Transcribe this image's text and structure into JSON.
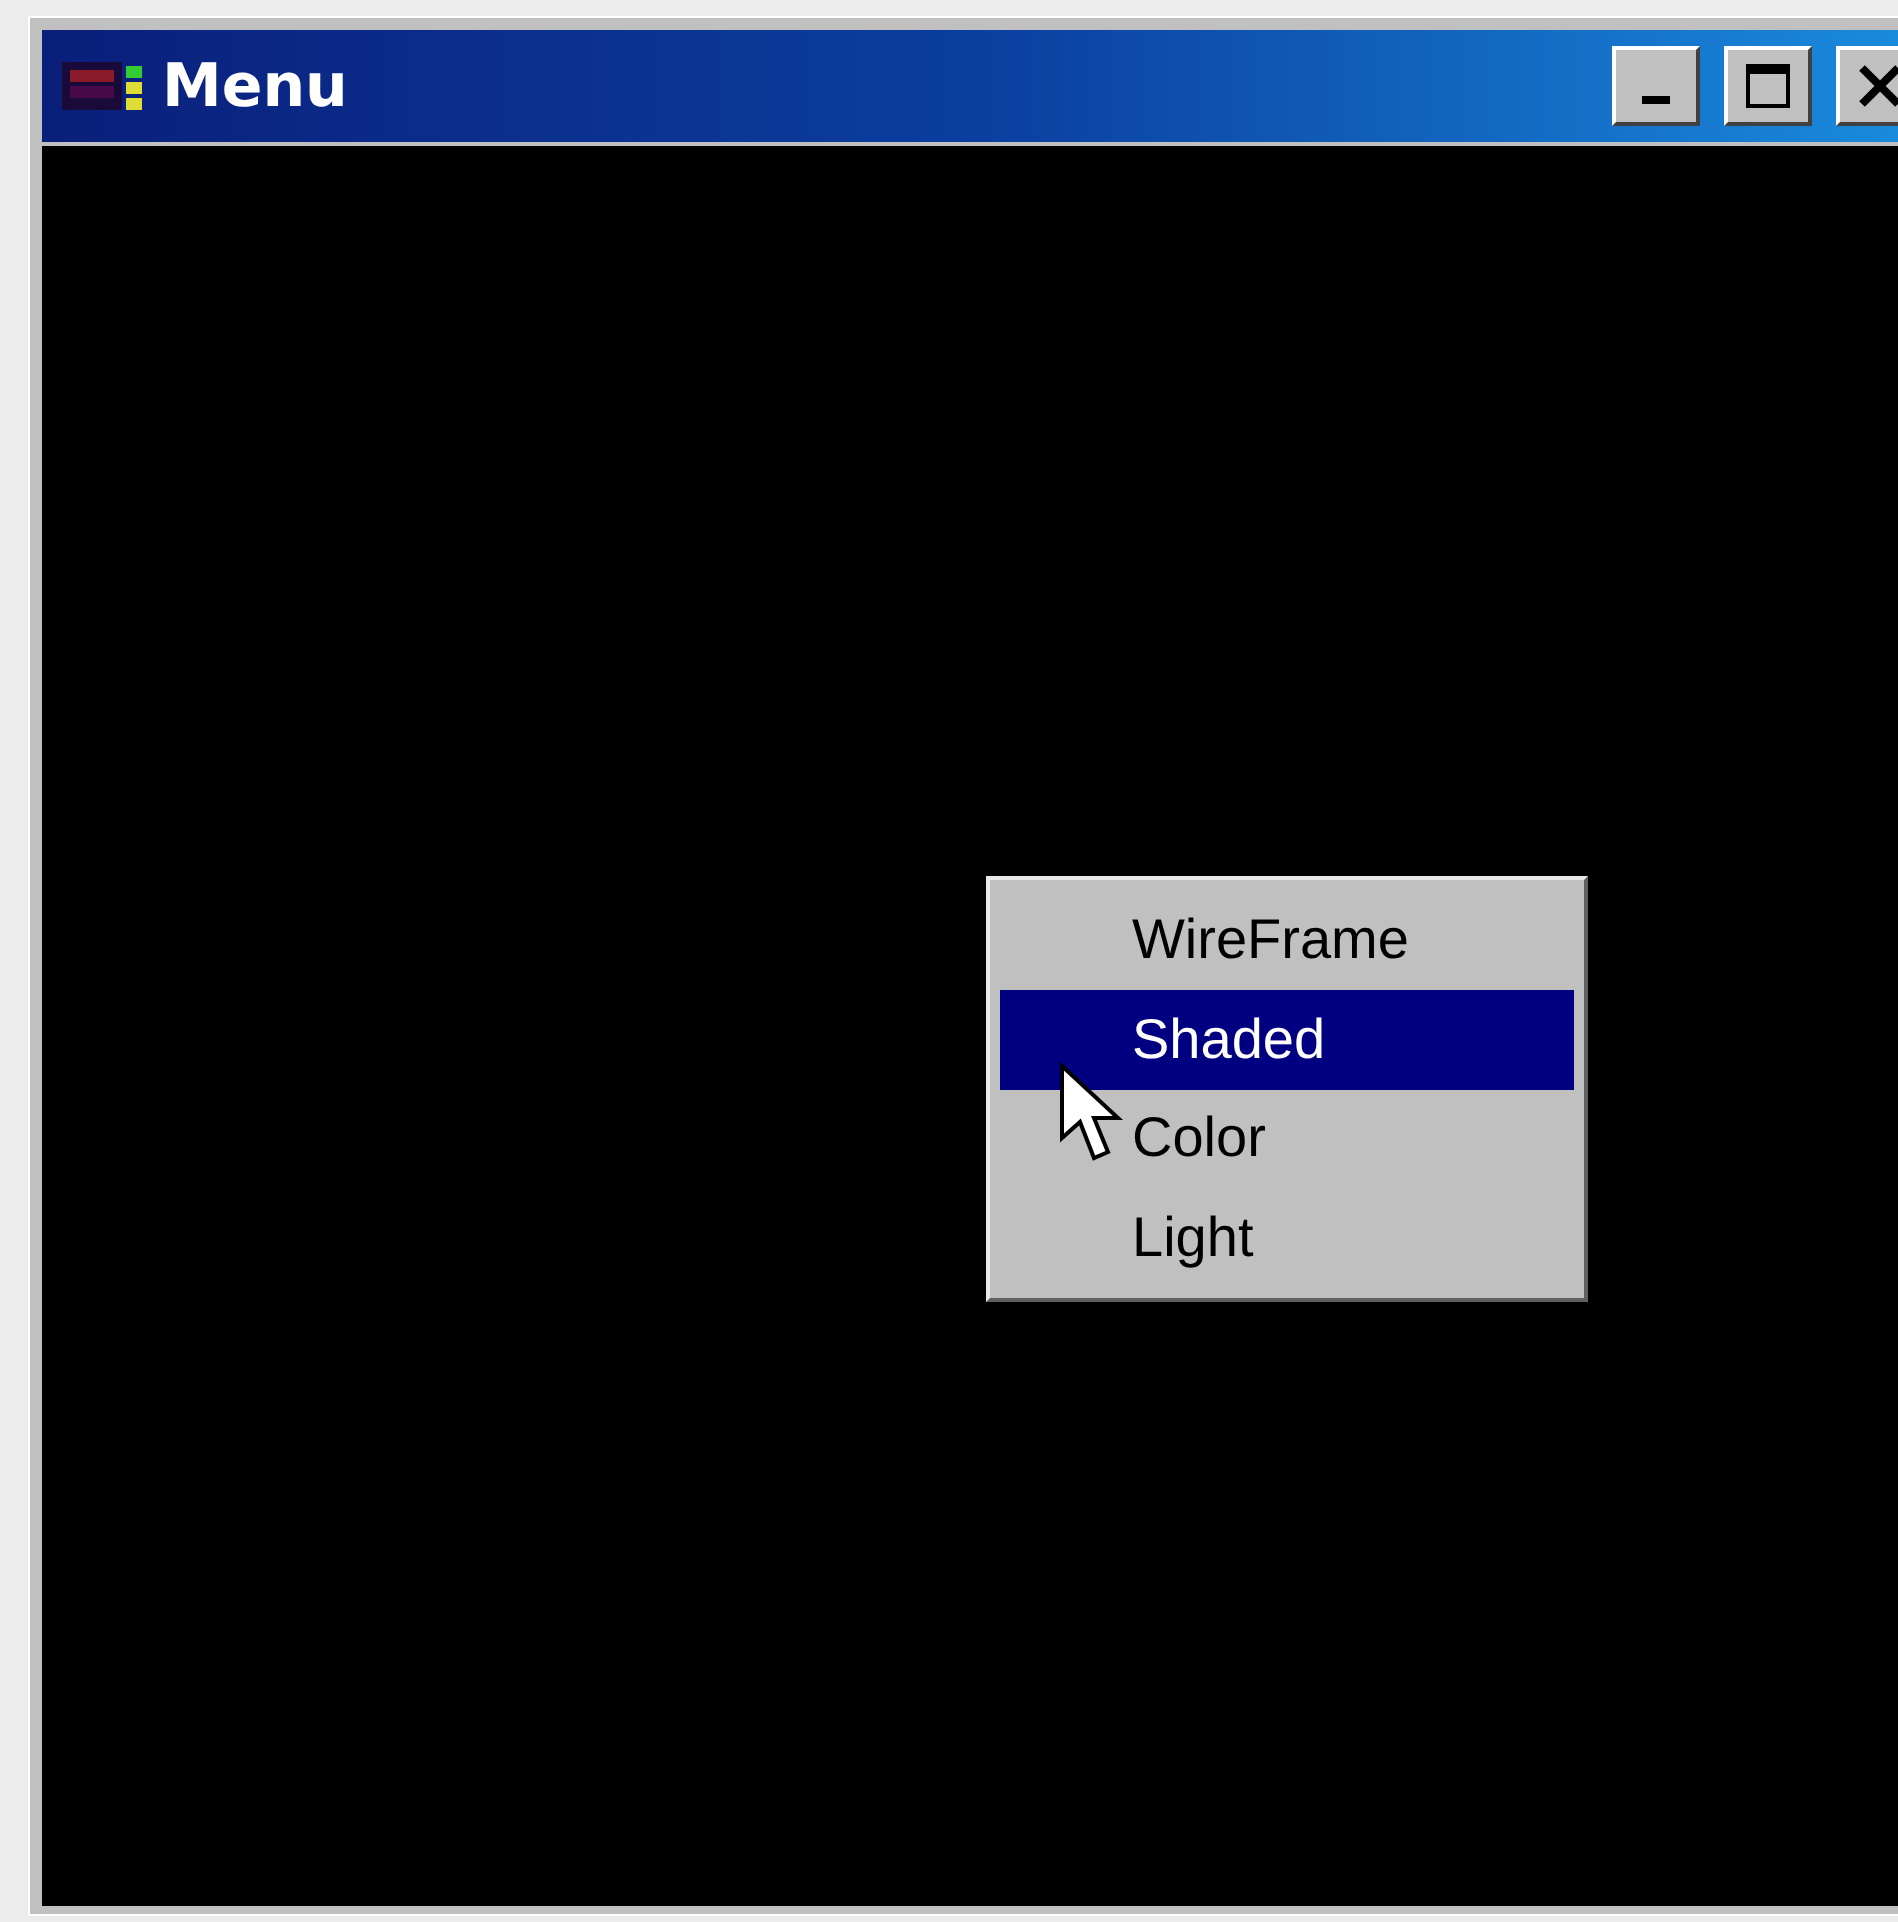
{
  "window": {
    "title": "Menu"
  },
  "title_buttons": [
    {
      "kind": "minimize"
    },
    {
      "kind": "maximize"
    },
    {
      "kind": "close"
    }
  ],
  "context_menu": {
    "items": [
      {
        "label": "WireFrame",
        "selected": false
      },
      {
        "label": "Shaded",
        "selected": true
      },
      {
        "label": "Color",
        "selected": false
      },
      {
        "label": "Light",
        "selected": false
      }
    ]
  }
}
